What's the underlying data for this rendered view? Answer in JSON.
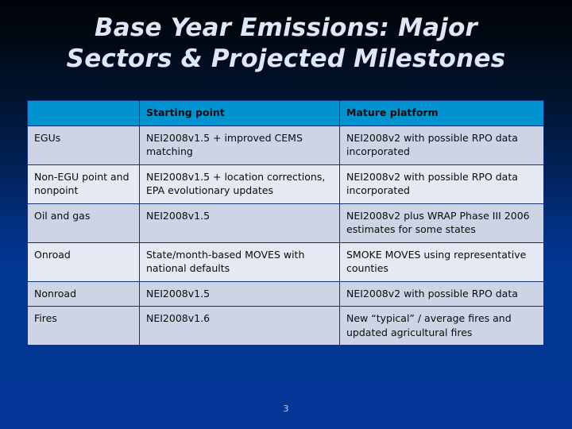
{
  "slide": {
    "title_lines": [
      "Base Year Emissions: Major",
      "Sectors & Projected Milestones"
    ],
    "page_number": "3",
    "colors": {
      "background_top": "#000208",
      "background_bottom": "#023595",
      "header_fill": "#0093cf",
      "header_text": "#ffffff",
      "row_shade_dark": "#ccd4e6",
      "row_shade_light": "#e4e9f4",
      "cell_border": "#16307c",
      "title_text": "#dfe6f7",
      "page_number_text": "#c9d6ef"
    }
  },
  "table": {
    "headers": {
      "sector": "",
      "starting_point": "Starting point",
      "mature_platform": "Mature platform"
    },
    "rows": [
      {
        "sector": "EGUs",
        "starting_point": "NEI2008v1.5 + improved CEMS matching",
        "mature_platform": "NEI2008v2 with possible RPO data incorporated",
        "shade": "dark"
      },
      {
        "sector": "Non-EGU point and nonpoint",
        "starting_point": "NEI2008v1.5 + location corrections, EPA evolutionary updates",
        "mature_platform": "NEI2008v2 with possible RPO data incorporated",
        "shade": "light"
      },
      {
        "sector": "Oil and gas",
        "starting_point": "NEI2008v1.5",
        "mature_platform": "NEI2008v2 plus WRAP Phase III 2006 estimates for some states",
        "shade": "dark"
      },
      {
        "sector": "Onroad",
        "starting_point": "State/month-based MOVES with national defaults",
        "mature_platform": "SMOKE MOVES using representative counties",
        "shade": "light"
      },
      {
        "sector": "Nonroad",
        "starting_point": "NEI2008v1.5",
        "mature_platform": "NEI2008v2 with possible RPO data",
        "shade": "dark"
      },
      {
        "sector": "Fires",
        "starting_point": "NEI2008v1.6",
        "mature_platform": "New “typical” / average fires and updated agricultural fires",
        "shade": "dark"
      }
    ]
  }
}
